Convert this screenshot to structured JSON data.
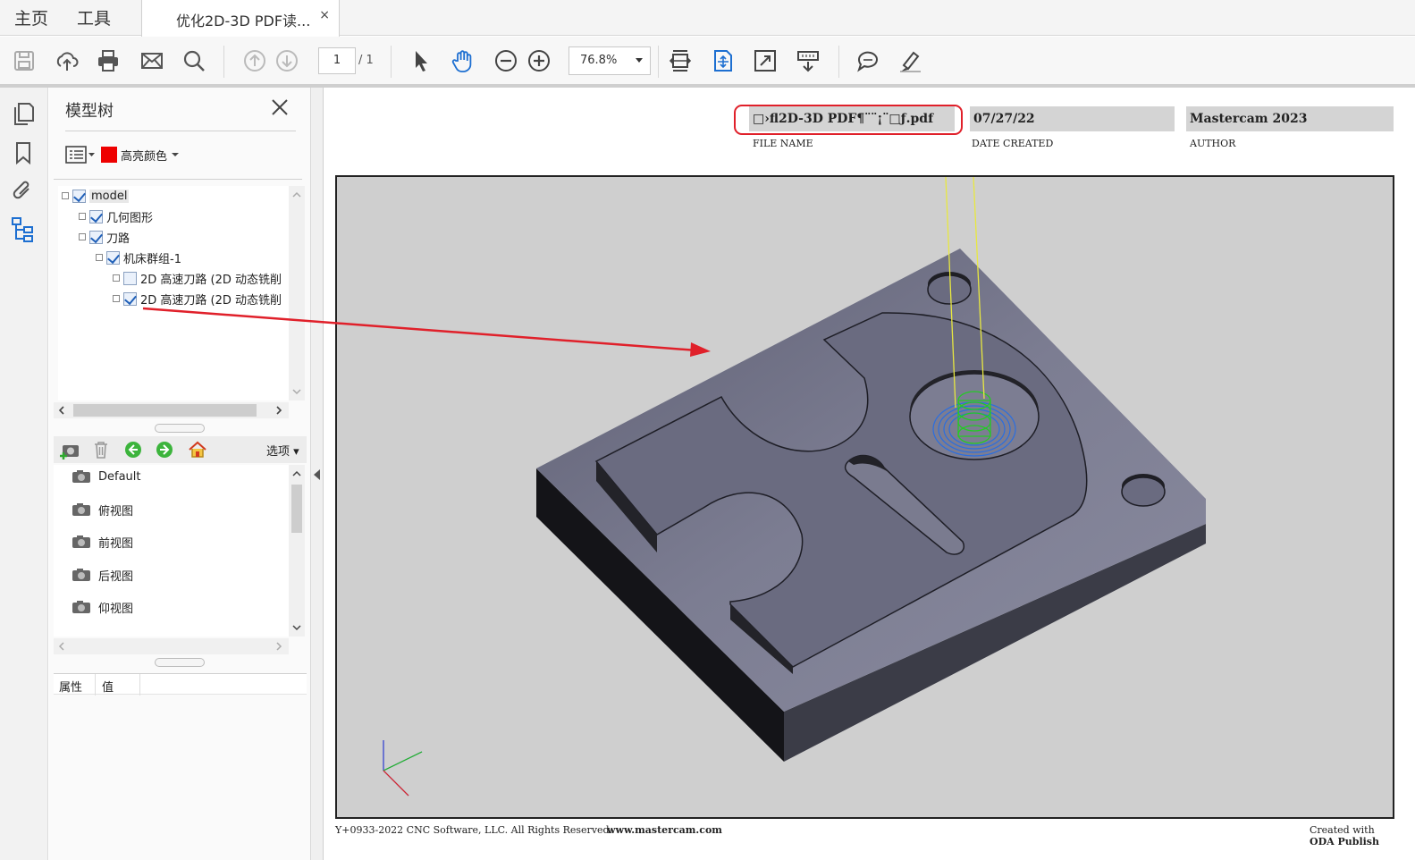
{
  "menu": {
    "home": "主页",
    "tools": "工具"
  },
  "tab": {
    "title": "优化2D-3D PDF读...",
    "close": "×"
  },
  "toolbar": {
    "icons": [
      "save-icon",
      "upload-cloud-icon",
      "print-icon",
      "email-icon",
      "search-icon",
      "page-up-icon",
      "page-down-icon",
      "select-cursor-icon",
      "hand-tool-icon",
      "zoom-out-icon",
      "zoom-in-icon",
      "fit-width-icon",
      "fit-page-icon",
      "fullscreen-icon",
      "scroll-mode-icon",
      "comment-icon",
      "highlighter-icon"
    ],
    "page_current": "1",
    "page_total": "/ 1",
    "zoom": "76.8%"
  },
  "model_tree": {
    "title": "模型树",
    "highlight_label": "高亮颜色",
    "highlight_color": "#ee0000",
    "nodes": [
      {
        "label": "model",
        "checked": true
      },
      {
        "label": "几何图形",
        "checked": true
      },
      {
        "label": "刀路",
        "checked": true
      },
      {
        "label": "机床群组-1",
        "checked": true
      },
      {
        "label": "2D 高速刀路 (2D 动态铣削",
        "checked": false
      },
      {
        "label": "2D 高速刀路 (2D 动态铣削",
        "checked": true
      }
    ]
  },
  "views": {
    "options_label": "选项",
    "items": [
      "Default",
      "俯视图",
      "前视图",
      "后视图",
      "仰视图"
    ]
  },
  "properties": {
    "col_attr": "属性",
    "col_value": "值"
  },
  "document": {
    "file_name_value": "□›fl2D-3D PDF¶¨¨¡¨□ƒ.pdf",
    "date_value": "07/27/22",
    "author_value": "Mastercam 2023",
    "file_name_label": "FILE NAME",
    "date_label": "DATE CREATED",
    "author_label": "AUTHOR",
    "footer_copyright": "Y+0933-2022 CNC Software, LLC. All Rights Reserved.",
    "footer_url": "www.mastercam.com",
    "footer_created_1": "Created with",
    "footer_created_2": "ODA Publish"
  },
  "colors": {
    "annotation_red": "#e0202a",
    "toolpath_green": "#22cc22",
    "toolpath_blue": "#2a6ee0",
    "tool_axis_yellow": "#e8e840"
  }
}
